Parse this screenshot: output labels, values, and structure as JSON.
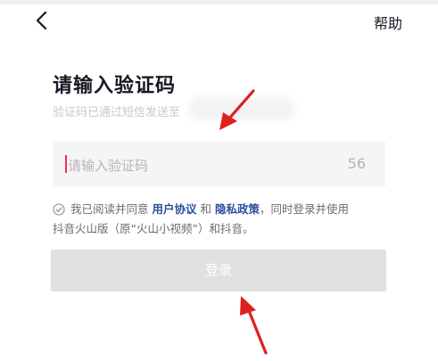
{
  "header": {
    "help_label": "帮助",
    "back_icon": "chevron-left-icon"
  },
  "main": {
    "title": "请输入验证码",
    "subtitle": "验证码已通过短信发送至"
  },
  "code_input": {
    "placeholder": "请输入验证码",
    "countdown": "56"
  },
  "agreement": {
    "prefix": "我已阅读并同意",
    "user_agreement": "用户协议",
    "and": "和",
    "privacy_policy": "隐私政策",
    "suffix_line1": "，同时登录并使用",
    "line2": "抖音火山版（原“火山小视频”）和抖音。"
  },
  "login_button": {
    "label": "登录"
  },
  "colors": {
    "accent": "#fe2c55",
    "link": "#2a4f9c",
    "annotation_arrow": "#e02020",
    "disabled_button": "#e1e1e3"
  }
}
